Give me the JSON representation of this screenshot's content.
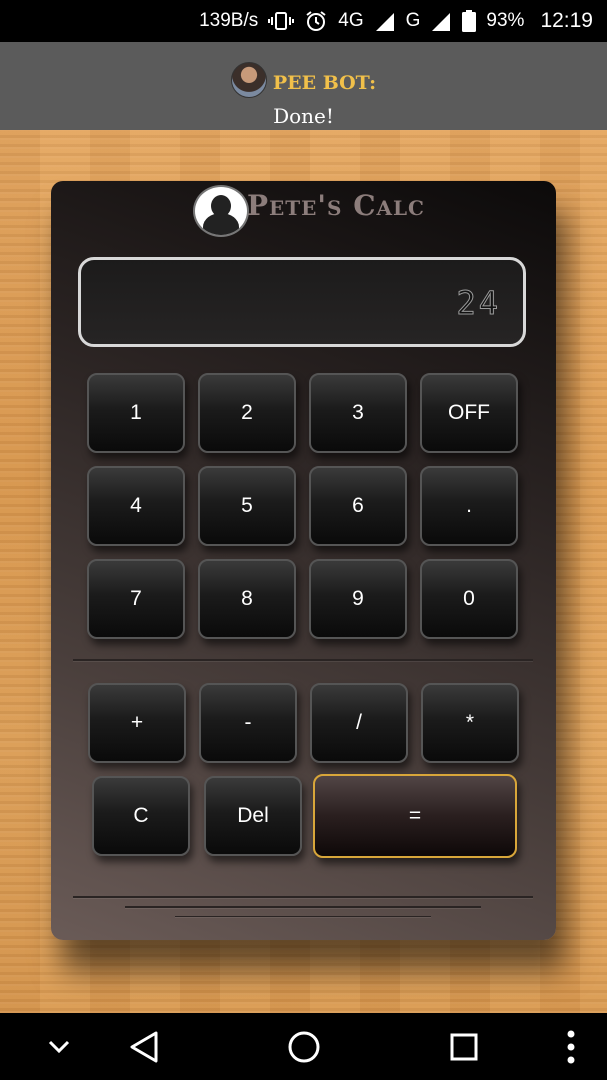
{
  "status_bar": {
    "net_speed": "139B/s",
    "network_4g": "4G",
    "network_g": "G",
    "battery": "93%",
    "time": "12:19"
  },
  "notification": {
    "sender": "PEE BOT:",
    "message": "Done!"
  },
  "calculator": {
    "title": "Pete's Calc",
    "display_value": "24",
    "buttons": {
      "b1": "1",
      "b2": "2",
      "b3": "3",
      "off": "OFF",
      "b4": "4",
      "b5": "5",
      "b6": "6",
      "dot": ".",
      "b7": "7",
      "b8": "8",
      "b9": "9",
      "b0": "0",
      "plus": "+",
      "minus": "-",
      "divide": "/",
      "multiply": "*",
      "clear": "C",
      "del": "Del",
      "equals": "="
    }
  },
  "nav_bar": {
    "icons": [
      "chevron-down-icon",
      "back-icon",
      "home-icon",
      "recents-icon",
      "more-icon"
    ]
  },
  "colors": {
    "notif_sender": "#f1c04a",
    "equals_border": "#d8a63a",
    "title": "#8c7d7b"
  }
}
